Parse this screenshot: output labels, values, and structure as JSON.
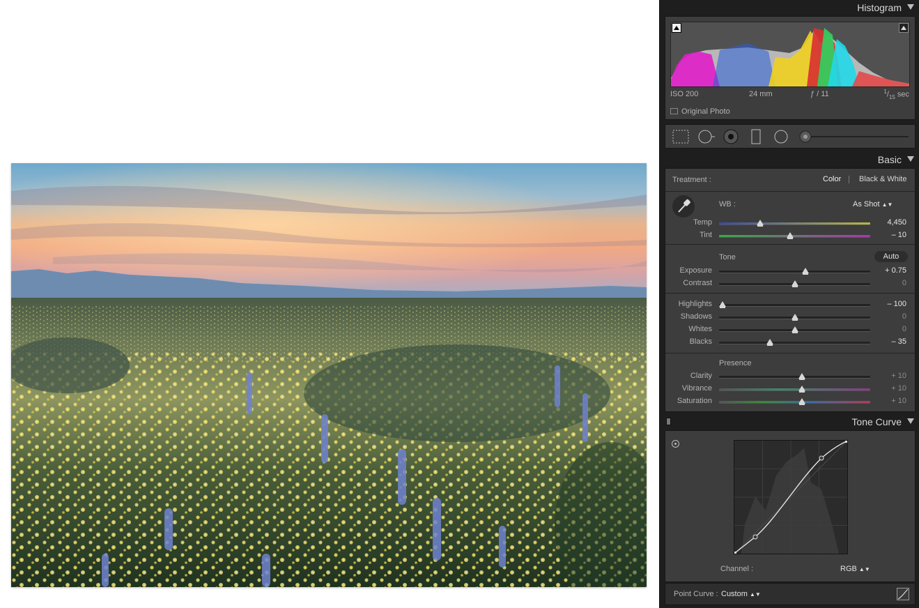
{
  "histogram": {
    "title": "Histogram",
    "iso": "ISO 200",
    "focal": "24 mm",
    "aperture": "ƒ / 11",
    "shutter_num": "1",
    "shutter_den": "15",
    "shutter_unit": "sec",
    "original_photo": "Original Photo"
  },
  "basic": {
    "title": "Basic",
    "treatment_label": "Treatment :",
    "treatment_color": "Color",
    "treatment_bw": "Black & White",
    "wb_label": "WB :",
    "wb_value": "As Shot",
    "tone_label": "Tone",
    "auto_label": "Auto",
    "presence_label": "Presence",
    "sliders": {
      "temp": {
        "label": "Temp",
        "value": "4,450",
        "level": 0.26
      },
      "tint": {
        "label": "Tint",
        "value": "– 10",
        "level": 0.47
      },
      "exposure": {
        "label": "Exposure",
        "value": "+ 0.75",
        "level": 0.575
      },
      "contrast": {
        "label": "Contrast",
        "value": "0",
        "level": 0.5
      },
      "highlights": {
        "label": "Highlights",
        "value": "– 100",
        "level": 0.0
      },
      "shadows": {
        "label": "Shadows",
        "value": "0",
        "level": 0.5
      },
      "whites": {
        "label": "Whites",
        "value": "0",
        "level": 0.5
      },
      "blacks": {
        "label": "Blacks",
        "value": "– 35",
        "level": 0.33
      },
      "clarity": {
        "label": "Clarity",
        "value": "+ 10",
        "level": 0.55
      },
      "vibrance": {
        "label": "Vibrance",
        "value": "+ 10",
        "level": 0.55
      },
      "saturation": {
        "label": "Saturation",
        "value": "+ 10",
        "level": 0.55
      }
    }
  },
  "tone_curve": {
    "title": "Tone Curve",
    "channel_label": "Channel :",
    "channel_value": "RGB",
    "point_curve_label": "Point Curve :",
    "point_curve_value": "Custom"
  },
  "colors": {
    "panel_bg": "#1e1e1e",
    "section_bg": "#3d3d3d",
    "text": "#cfcfcf"
  }
}
